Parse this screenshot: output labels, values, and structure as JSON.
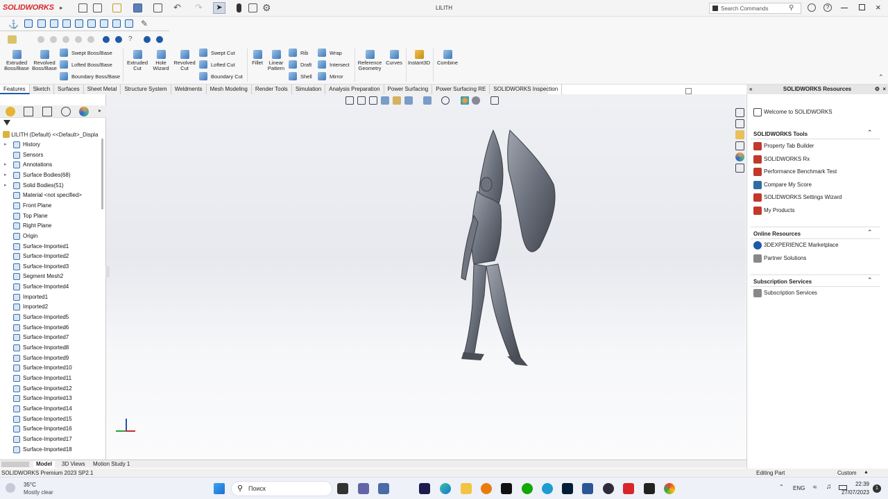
{
  "app": {
    "logo": "SOLIDWORKS",
    "document_title": "LILITH"
  },
  "search": {
    "placeholder": "Search Commands"
  },
  "ribbon": {
    "big_buttons": [
      {
        "id": "extruded-boss",
        "label": "Extruded\nBoss/Base"
      },
      {
        "id": "revolved-boss",
        "label": "Revolved\nBoss/Base"
      },
      {
        "id": "extruded-cut",
        "label": "Extruded\nCut"
      },
      {
        "id": "hole-wizard",
        "label": "Hole\nWizard"
      },
      {
        "id": "revolved-cut",
        "label": "Revolved\nCut"
      },
      {
        "id": "fillet",
        "label": "Fillet"
      },
      {
        "id": "linear-pattern",
        "label": "Linear\nPattern"
      },
      {
        "id": "reference-geometry",
        "label": "Reference\nGeometry"
      },
      {
        "id": "curves",
        "label": "Curves"
      },
      {
        "id": "instant3d",
        "label": "Instant3D"
      },
      {
        "id": "combine",
        "label": "Combine"
      }
    ],
    "small_buttons": {
      "swept_boss": "Swept Boss/Base",
      "lofted_boss": "Lofted Boss/Base",
      "boundary_boss": "Boundary Boss/Base",
      "swept_cut": "Swept Cut",
      "lofted_cut": "Lofted Cut",
      "boundary_cut": "Boundary Cut",
      "rib": "Rib",
      "draft": "Draft",
      "shell": "Shell",
      "wrap": "Wrap",
      "intersect": "Intersect",
      "mirror": "Mirror"
    }
  },
  "tabs": [
    "Features",
    "Sketch",
    "Surfaces",
    "Sheet Metal",
    "Structure System",
    "Weldments",
    "Mesh Modeling",
    "Render Tools",
    "Simulation",
    "Analysis Preparation",
    "Power Surfacing",
    "Power Surfacing RE",
    "SOLIDWORKS Inspection"
  ],
  "tree": {
    "root": "LILITH (Default) <<Default>_Displa",
    "items": [
      {
        "label": "History",
        "expand": true
      },
      {
        "label": "Sensors",
        "expand": false
      },
      {
        "label": "Annotations",
        "expand": true
      },
      {
        "label": "Surface Bodies(68)",
        "expand": true
      },
      {
        "label": "Solid Bodies(51)",
        "expand": true
      },
      {
        "label": "Material <not specified>",
        "expand": false
      },
      {
        "label": "Front Plane",
        "expand": false
      },
      {
        "label": "Top Plane",
        "expand": false
      },
      {
        "label": "Right Plane",
        "expand": false
      },
      {
        "label": "Origin",
        "expand": false
      },
      {
        "label": "Surface-Imported1",
        "expand": false
      },
      {
        "label": "Surface-Imported2",
        "expand": false
      },
      {
        "label": "Surface-Imported3",
        "expand": false
      },
      {
        "label": "Segment Mesh2",
        "expand": false
      },
      {
        "label": "Surface-Imported4",
        "expand": false
      },
      {
        "label": "Imported1",
        "expand": false
      },
      {
        "label": "Imported2",
        "expand": false
      },
      {
        "label": "Surface-Imported5",
        "expand": false
      },
      {
        "label": "Surface-Imported6",
        "expand": false
      },
      {
        "label": "Surface-Imported7",
        "expand": false
      },
      {
        "label": "Surface-Imported8",
        "expand": false
      },
      {
        "label": "Surface-Imported9",
        "expand": false
      },
      {
        "label": "Surface-Imported10",
        "expand": false
      },
      {
        "label": "Surface-Imported11",
        "expand": false
      },
      {
        "label": "Surface-Imported12",
        "expand": false
      },
      {
        "label": "Surface-Imported13",
        "expand": false
      },
      {
        "label": "Surface-Imported14",
        "expand": false
      },
      {
        "label": "Surface-Imported15",
        "expand": false
      },
      {
        "label": "Surface-Imported16",
        "expand": false
      },
      {
        "label": "Surface-Imported17",
        "expand": false
      },
      {
        "label": "Surface-Imported18",
        "expand": false
      }
    ]
  },
  "bottom_tabs": [
    "Model",
    "3D Views",
    "Motion Study 1"
  ],
  "status": {
    "left": "SOLIDWORKS Premium 2023 SP2.1",
    "editing": "Editing Part",
    "units": "Custom"
  },
  "resources": {
    "title": "SOLIDWORKS Resources",
    "welcome": "Welcome to SOLIDWORKS",
    "sections": [
      {
        "title": "SOLIDWORKS Tools",
        "items": [
          "Property Tab Builder",
          "SOLIDWORKS Rx",
          "Performance Benchmark Test",
          "Compare My Score",
          "SOLIDWORKS Settings Wizard",
          "My Products"
        ]
      },
      {
        "title": "Online Resources",
        "items": [
          "3DEXPERIENCE Marketplace",
          "Partner Solutions"
        ]
      },
      {
        "title": "Subscription Services",
        "items": [
          "Subscription Services"
        ]
      }
    ]
  },
  "taskbar": {
    "weather_temp": "35°C",
    "weather_desc": "Mostly clear",
    "search_label": "Поиск",
    "lang": "ENG",
    "time": "22:39",
    "date": "27/07/2023",
    "notification_count": "1"
  },
  "colors": {
    "accent": "#1e5aa8",
    "brand": "#d8262c"
  }
}
